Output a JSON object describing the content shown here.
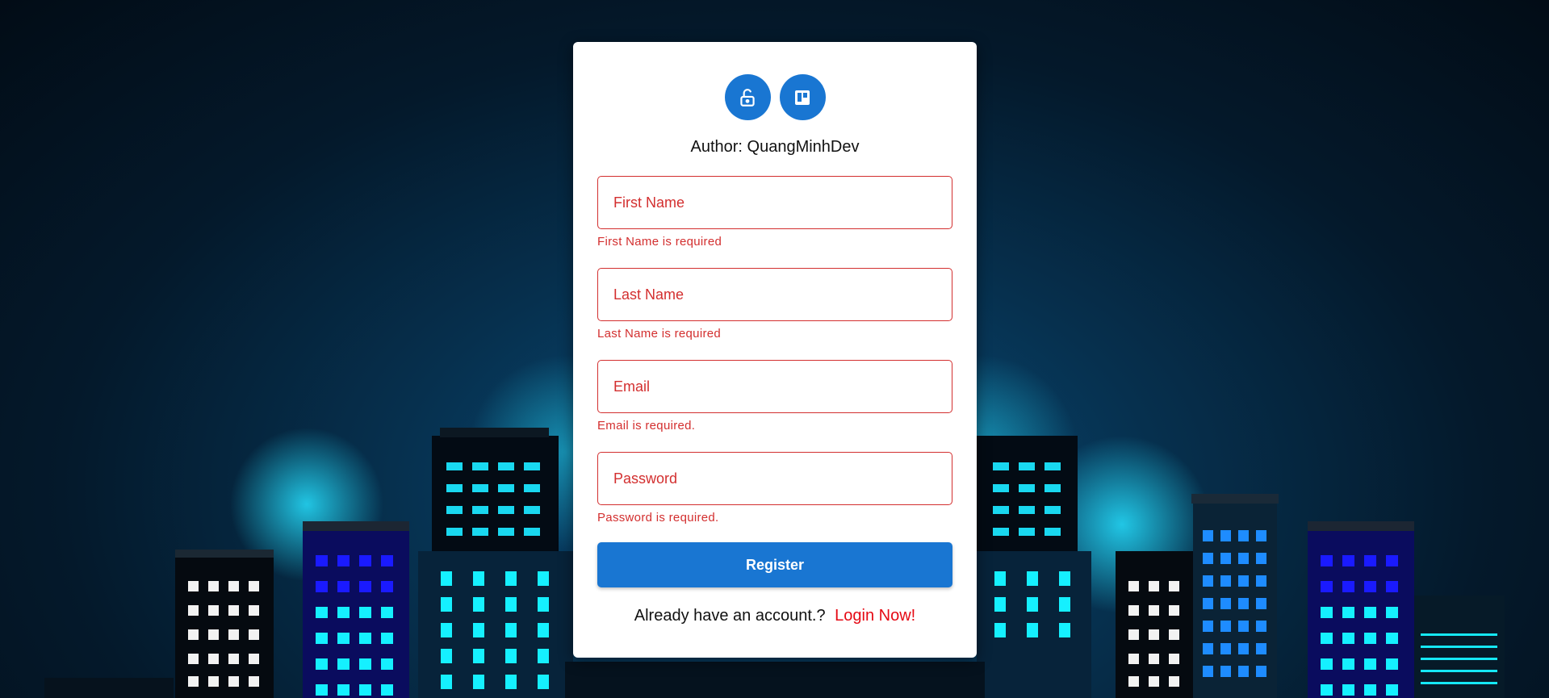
{
  "colors": {
    "primary": "#1976d2",
    "error": "#d32f2f",
    "link": "#e50914"
  },
  "header": {
    "icons": [
      "lock-open-icon",
      "trello-board-icon"
    ],
    "author": "Author: QuangMinhDev"
  },
  "form": {
    "fields": [
      {
        "placeholder": "First Name",
        "value": "",
        "error": "First Name is required"
      },
      {
        "placeholder": "Last Name",
        "value": "",
        "error": "Last Name is required"
      },
      {
        "placeholder": "Email",
        "value": "",
        "error": "Email is required."
      },
      {
        "placeholder": "Password",
        "value": "",
        "error": "Password is required."
      }
    ],
    "submit_label": "Register"
  },
  "footer": {
    "prompt": "Already have an account.?",
    "login_link": "Login Now!"
  }
}
